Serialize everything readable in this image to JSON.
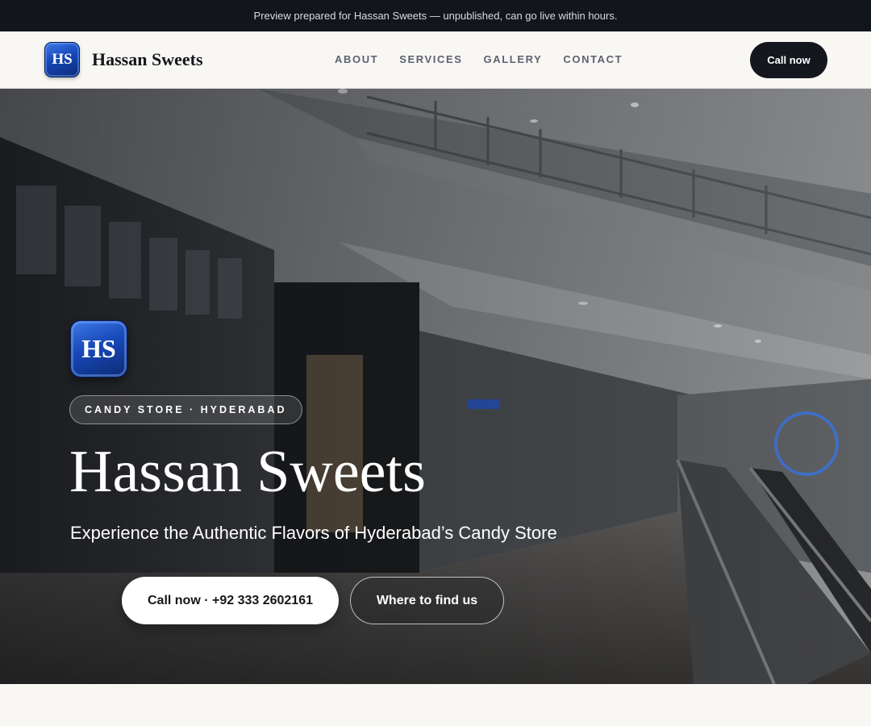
{
  "topbar": {
    "text": "Preview prepared for Hassan Sweets — unpublished, can go live within hours."
  },
  "nav": {
    "logo_initials": "HS",
    "brand_name": "Hassan Sweets",
    "links": [
      "ABOUT",
      "SERVICES",
      "GALLERY",
      "CONTACT"
    ],
    "cta_label": "Call now"
  },
  "hero": {
    "logo_initials": "HS",
    "badge": "CANDY STORE · HYDERABAD",
    "title": "Hassan Sweets",
    "subtitle": "Experience the Authentic Flavors of Hyderabad’s Candy Store",
    "primary_button": "Call now · +92 333 2602161",
    "secondary_button": "Where to find us",
    "background_image": "shopping-mall-interior-photo"
  },
  "colors": {
    "topbar_bg": "#12151b",
    "nav_bg": "#f8f7f4",
    "cta_bg": "#14171d",
    "logo_blue": "#1748b8"
  }
}
